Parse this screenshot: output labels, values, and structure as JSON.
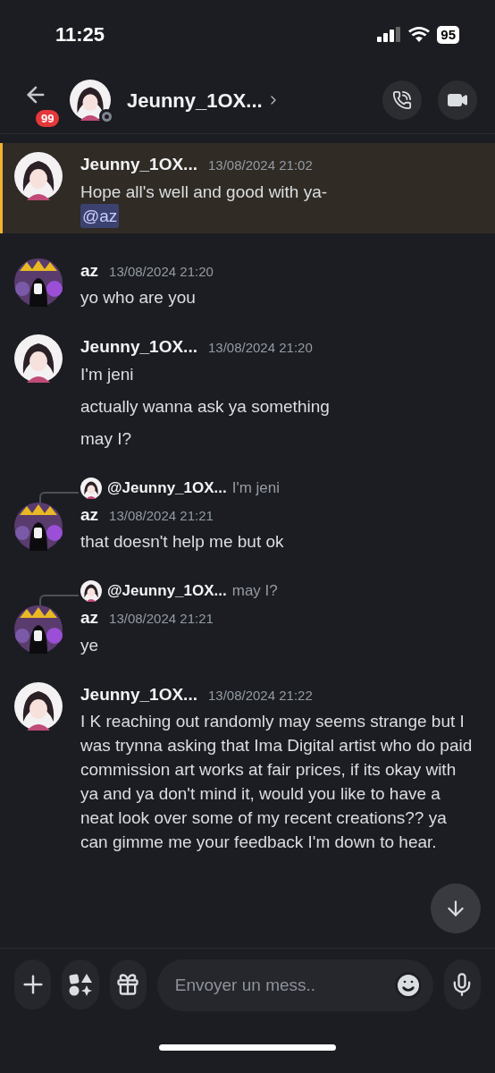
{
  "status_bar": {
    "time": "11:25",
    "battery": "95"
  },
  "header": {
    "unread_badge": "99",
    "title": "Jeunny_1OX..."
  },
  "messages": [
    {
      "author": "Jeunny_1OX...",
      "kind": "girl",
      "timestamp": "13/08/2024 21:02",
      "highlighted": true,
      "lines": [
        "Hope all's well and good with ya-"
      ],
      "mention": "@az"
    },
    {
      "author": "az",
      "kind": "crowned",
      "timestamp": "13/08/2024 21:20",
      "highlighted": false,
      "lines": [
        "yo who are you"
      ]
    },
    {
      "author": "Jeunny_1OX...",
      "kind": "girl",
      "timestamp": "13/08/2024 21:20",
      "highlighted": false,
      "lines": [
        "I'm jeni",
        "actually wanna ask ya something",
        "may I?"
      ]
    },
    {
      "author": "az",
      "kind": "crowned",
      "timestamp": "13/08/2024 21:21",
      "highlighted": false,
      "reply": {
        "author": "@Jeunny_1OX...",
        "text": "I'm jeni"
      },
      "lines": [
        "that doesn't help me but ok"
      ]
    },
    {
      "author": "az",
      "kind": "crowned",
      "timestamp": "13/08/2024 21:21",
      "highlighted": false,
      "reply": {
        "author": "@Jeunny_1OX...",
        "text": "may I?"
      },
      "lines": [
        "ye"
      ]
    },
    {
      "author": "Jeunny_1OX...",
      "kind": "girl",
      "timestamp": "13/08/2024 21:22",
      "highlighted": false,
      "lines": [
        "I K reaching out randomly may seems strange but I was trynna asking that Ima Digital artist who do paid commission art works at fair prices, if its okay with ya and ya don't mind it, would you like to have a neat look over some of my recent creations?? ya can gimme me your feedback I'm down to hear."
      ]
    }
  ],
  "composer": {
    "placeholder": "Envoyer un mess.."
  }
}
